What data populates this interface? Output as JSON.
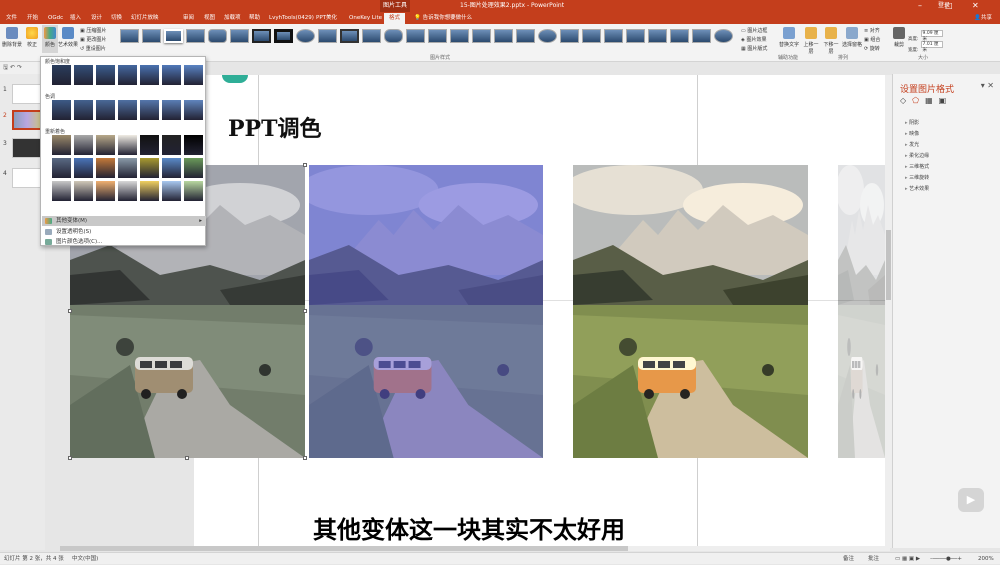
{
  "window": {
    "title": "15-图片处理效果2.pptx  -  PowerPoint",
    "context_tab_group": "图片工具",
    "user": "登录",
    "minimize": "–",
    "restore": "□",
    "close": "✕"
  },
  "menu": {
    "tabs": [
      "文件",
      "开始",
      "OGdc",
      "插入",
      "设计",
      "切换",
      "幻灯片放映",
      "审阅",
      "视图",
      "加载项",
      "帮助",
      "LvyhTools(0429)",
      "PPT美化",
      "OneKey Lite",
      "格式"
    ],
    "active_tab": "格式",
    "tell_me": "告诉我你想要做什么",
    "share": "共享"
  },
  "ribbon": {
    "remove_bg": "删除背景",
    "corrections": "校正",
    "color": "颜色",
    "artistic": "艺术效果",
    "compress": "压缩图片",
    "change_pic": "更改图片",
    "reset_pic": "重设图片",
    "styles_label": "图片样式",
    "border": "图片边框",
    "effects": "图片效果",
    "layout": "图片版式",
    "alt_text": "替换文字",
    "bring_fwd": "上移一层",
    "send_back": "下移一层",
    "sel_pane": "选择窗格",
    "align": "对齐",
    "group": "组合",
    "rotate": "旋转",
    "crop": "裁剪",
    "height_label": "高度:",
    "height_val": "9.09 厘米",
    "width_label": "宽度:",
    "width_val": "7.01 厘米",
    "arrange_label": "排列",
    "access_label": "辅助功能",
    "size_label": "大小"
  },
  "gallery": {
    "saturation_label": "颜色饱和度",
    "tone_label": "色调",
    "recolor_label": "重新着色",
    "menu_more": "其他变体(M)",
    "menu_transparent": "设置透明色(S)",
    "menu_options": "图片颜色选项(C)..."
  },
  "slide": {
    "title": "PPT调色",
    "subtitle": "其他变体这一块其实不太好用"
  },
  "pane": {
    "title": "设置图片格式",
    "items": [
      "阴影",
      "映像",
      "发光",
      "柔化边缘",
      "三维格式",
      "三维旋转",
      "艺术效果"
    ]
  },
  "slides": [
    {
      "num": "1"
    },
    {
      "num": "2"
    },
    {
      "num": "3"
    },
    {
      "num": "4"
    }
  ],
  "status": {
    "slide_info": "幻灯片 第 2 张，共 4 张",
    "language": "中文(中国)",
    "notes": "备注",
    "comments": "批注",
    "zoom": "200%"
  },
  "colors": {
    "accent": "#c43e1c",
    "teal": "#2fae97"
  }
}
